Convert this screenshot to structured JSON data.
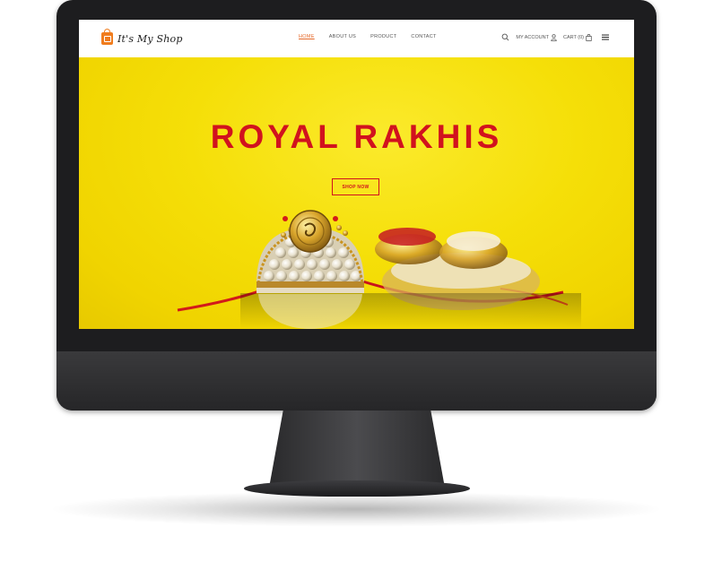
{
  "brand": {
    "name": "It's My Shop",
    "accent": "#f07c1d"
  },
  "nav": {
    "links": [
      {
        "label": "HOME",
        "active": true
      },
      {
        "label": "ABOUT US",
        "active": false
      },
      {
        "label": "PRODUCT",
        "active": false
      },
      {
        "label": "CONTACT",
        "active": false
      }
    ],
    "account_label": "MY ACCOUNT",
    "cart_label": "CART (0)",
    "icons": [
      "search-icon",
      "user-icon",
      "shopping-bag-icon",
      "menu-icon"
    ]
  },
  "hero": {
    "title": "ROYAL RAKHIS",
    "button_label": "SHOP NOW",
    "title_color": "#d1121e",
    "background_color": "#f5df08"
  }
}
